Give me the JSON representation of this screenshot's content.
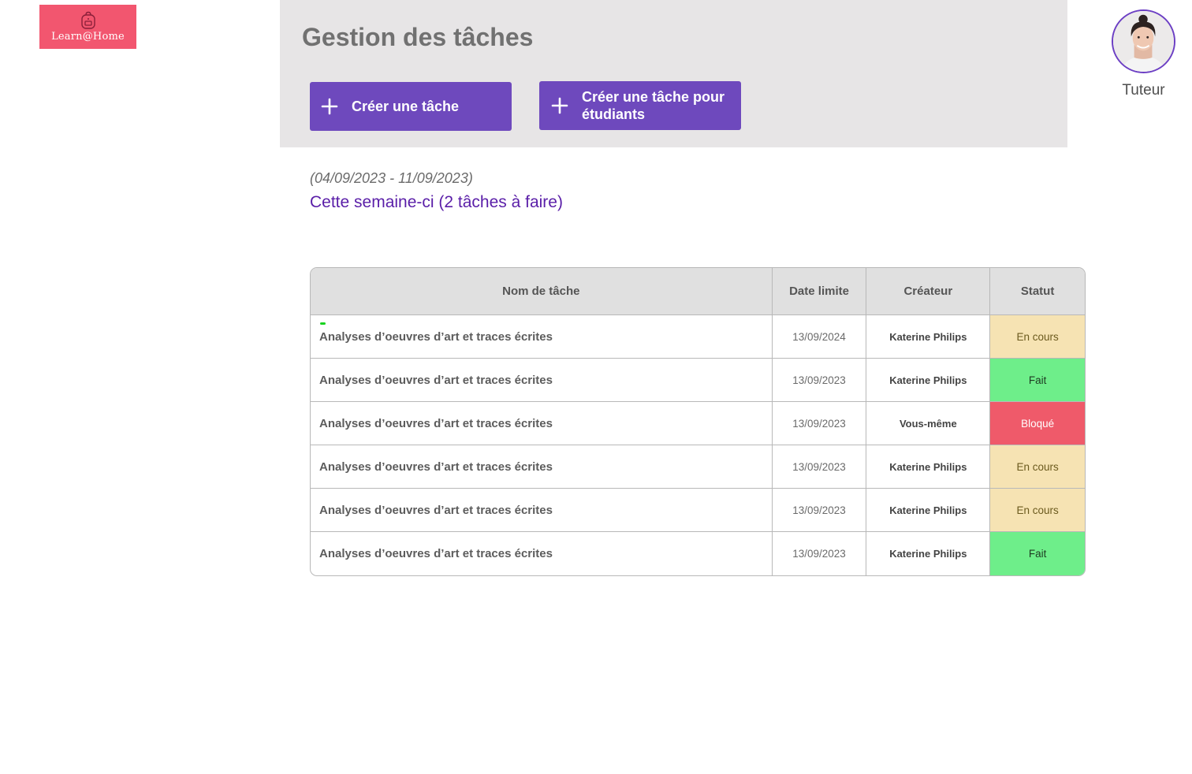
{
  "app": {
    "logo_text": "Learn@Home",
    "logo_icon": "backpack-icon"
  },
  "header": {
    "title": "Gestion des tâches",
    "buttons": [
      {
        "label": "Créer une tâche",
        "icon": "plus-icon"
      },
      {
        "label": "Créer une tâche pour étudiants",
        "icon": "plus-icon"
      }
    ]
  },
  "user": {
    "role": "Tuteur"
  },
  "week": {
    "range": "(04/09/2023 - 11/09/2023)",
    "title": "Cette semaine-ci (2 tâches à faire)"
  },
  "table": {
    "columns": [
      "Nom de tâche",
      "Date limite",
      "Créateur",
      "Statut"
    ],
    "rows": [
      {
        "name": "Analyses d’oeuvres d’art et traces écrites",
        "date": "13/09/2024",
        "creator": "Katerine Philips",
        "status": "En cours",
        "status_bg": "#f6e3b3",
        "status_fg": "#6b5a1e",
        "new": true
      },
      {
        "name": "Analyses d’oeuvres d’art et traces écrites",
        "date": "13/09/2023",
        "creator": "Katerine Philips",
        "status": "Fait",
        "status_bg": "#6eee8a",
        "status_fg": "#1e3b22"
      },
      {
        "name": "Analyses d’oeuvres d’art et traces écrites",
        "date": "13/09/2023",
        "creator": "Vous-même",
        "status": "Bloqué",
        "status_bg": "#ef5a6a",
        "status_fg": "#ffffff"
      },
      {
        "name": "Analyses d’oeuvres d’art et traces écrites",
        "date": "13/09/2023",
        "creator": "Katerine Philips",
        "status": "En cours",
        "status_bg": "#f6e3b3",
        "status_fg": "#6b5a1e"
      },
      {
        "name": "Analyses d’oeuvres d’art et traces écrites",
        "date": "13/09/2023",
        "creator": "Katerine Philips",
        "status": "En cours",
        "status_bg": "#f6e3b3",
        "status_fg": "#6b5a1e"
      },
      {
        "name": "Analyses d’oeuvres d’art et traces écrites",
        "date": "13/09/2023",
        "creator": "Katerine Philips",
        "status": "Fait",
        "status_bg": "#6eee8a",
        "status_fg": "#1e3b22"
      }
    ]
  },
  "colors": {
    "accent": "#6e49bd",
    "brand": "#f2566f",
    "heading": "#5a1ea8",
    "new_indicator": "#19d31f"
  }
}
